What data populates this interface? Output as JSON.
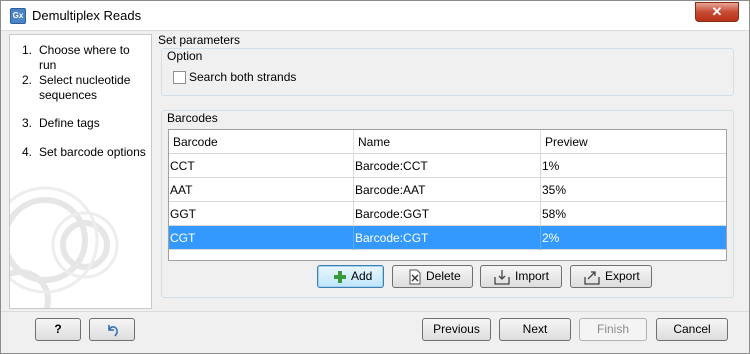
{
  "window": {
    "title": "Demultiplex Reads",
    "app_icon_text": "Gx",
    "close_symbol": "✕"
  },
  "steps": [
    {
      "num": "1.",
      "label": "Choose where to run"
    },
    {
      "num": "2.",
      "label": "Select nucleotide sequences"
    },
    {
      "num": "3.",
      "label": "Define tags"
    },
    {
      "num": "4.",
      "label": "Set barcode options"
    }
  ],
  "main": {
    "section_title": "Set parameters",
    "option_group": {
      "title": "Option",
      "checkbox_label": "Search both strands",
      "checked": false
    },
    "barcodes_group": {
      "title": "Barcodes",
      "columns": [
        "Barcode",
        "Name",
        "Preview"
      ],
      "rows": [
        {
          "barcode": "CCT",
          "name": "Barcode:CCT",
          "preview": "1%"
        },
        {
          "barcode": "AAT",
          "name": "Barcode:AAT",
          "preview": "35%"
        },
        {
          "barcode": "GGT",
          "name": "Barcode:GGT",
          "preview": "58%"
        },
        {
          "barcode": "CGT",
          "name": "Barcode:CGT",
          "preview": "2%",
          "selected": true
        }
      ],
      "buttons": {
        "add": "Add",
        "delete": "Delete",
        "import": "Import",
        "export": "Export"
      }
    }
  },
  "footer": {
    "help": "?",
    "previous": "Previous",
    "next": "Next",
    "finish": "Finish",
    "cancel": "Cancel"
  },
  "colors": {
    "selection": "#3399ff",
    "add_icon": "#3a9a3a"
  }
}
